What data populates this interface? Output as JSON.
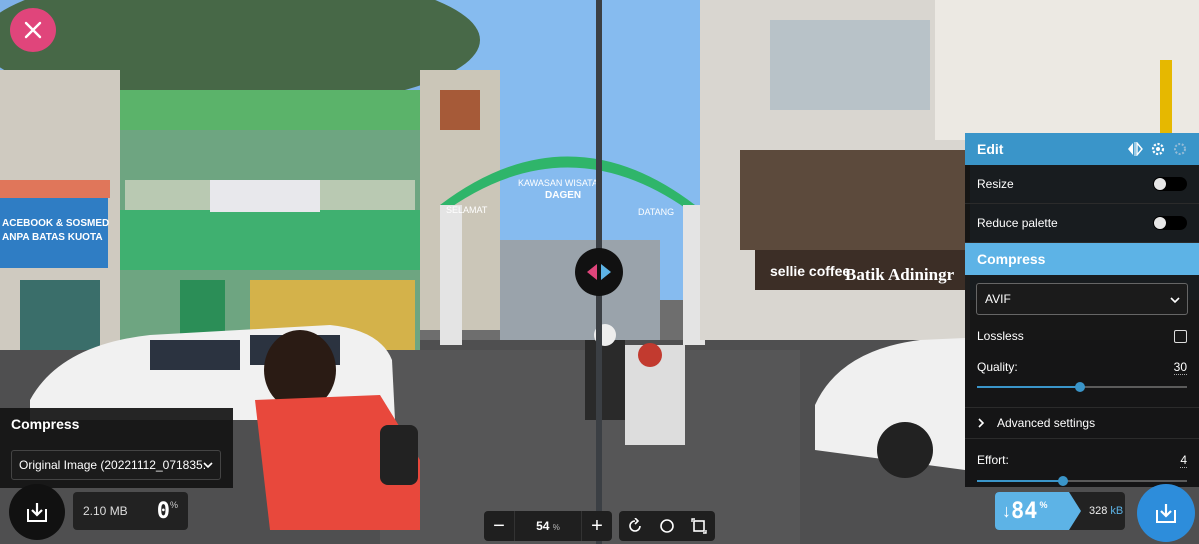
{
  "left_panel": {
    "title": "Compress",
    "selected_format": "Original Image (20221112_071835.",
    "original_size": "2.10 MB",
    "percent_value": "0",
    "percent_unit": "%"
  },
  "zoom": {
    "minus": "−",
    "value": "54",
    "unit": "%",
    "plus": "+"
  },
  "signs": {
    "shop_left": "ACEBOOK & SOSMED",
    "shop_left2": "ANPA BATAS KUOTA",
    "arch_top": "KAWASAN WISATA",
    "arch_mid": "DAGEN",
    "arch_left": "SELAMAT",
    "arch_right": "DATANG",
    "cafe": "sellie coffee",
    "batik": "Batik Adiningr"
  },
  "edit_panel": {
    "title": "Edit",
    "resize_label": "Resize",
    "reduce_palette_label": "Reduce palette",
    "compress_title": "Compress",
    "codec": "AVIF",
    "lossless_label": "Lossless",
    "quality_label": "Quality:",
    "quality_value": "30",
    "quality_fraction": 0.49,
    "advanced_label": "Advanced settings",
    "effort_label": "Effort:",
    "effort_value": "4",
    "effort_fraction": 0.41
  },
  "result": {
    "arrow": "↓",
    "percent": "84",
    "percent_unit": "%",
    "size": "328",
    "size_unit": "kB"
  },
  "colors": {
    "accent": "#3a95c9",
    "accent_light": "#5db3e6",
    "close": "#e0457b",
    "download_right": "#2d8ddb"
  }
}
